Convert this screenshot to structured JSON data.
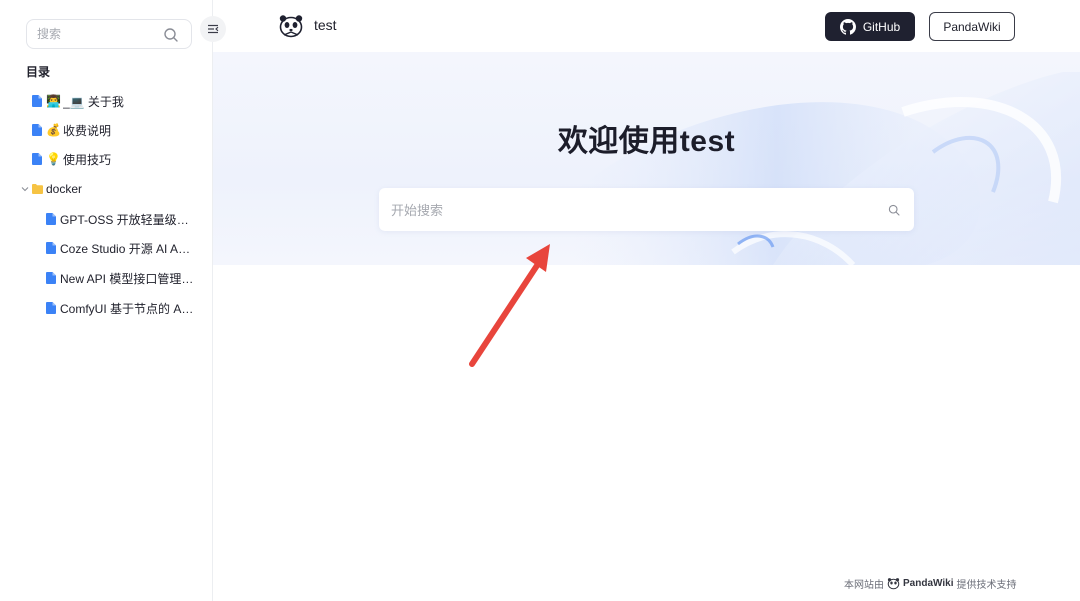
{
  "sidebar": {
    "search_placeholder": "搜索",
    "toc_title": "目录",
    "items": [
      {
        "emoji": "👨‍💻",
        "label": "_💻 关于我"
      },
      {
        "emoji": "💰",
        "label": "收费说明"
      },
      {
        "emoji": "💡",
        "label": "使用技巧"
      }
    ],
    "folder": {
      "label": "docker",
      "children": [
        {
          "label": "GPT-OSS 开放轻量级语..."
        },
        {
          "label": "Coze Studio 开源 AI Age..."
        },
        {
          "label": "New API 模型接口管理与..."
        },
        {
          "label": "ComfyUI 基于节点的 AI ..."
        }
      ]
    }
  },
  "header": {
    "brand": "test",
    "github_label": "GitHub",
    "pandawiki_label": "PandaWiki"
  },
  "hero": {
    "title": "欢迎使用test",
    "search_placeholder": "开始搜索"
  },
  "footer": {
    "prefix": "本网站由",
    "brand": "PandaWiki",
    "suffix": "提供技术支持"
  },
  "colors": {
    "primary_dark": "#1f2130",
    "doc_icon": "#3b82f6",
    "folder_icon": "#f6c343",
    "annotation_arrow": "#e8453c"
  }
}
